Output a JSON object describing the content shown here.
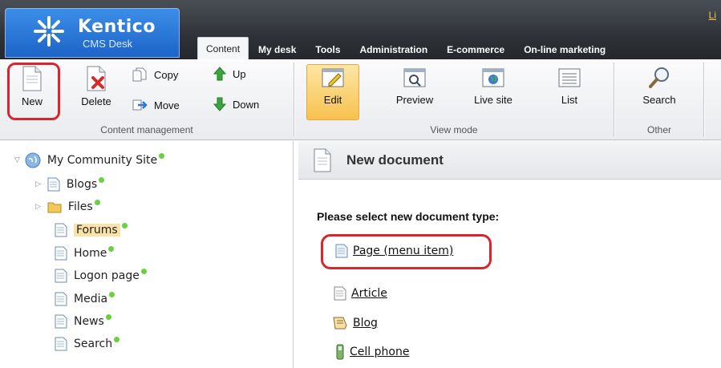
{
  "header": {
    "logo_title": "Kentico",
    "logo_subtitle": "CMS Desk",
    "corner_link": "Li",
    "tabs": [
      {
        "label": "Content",
        "active": true
      },
      {
        "label": "My desk",
        "active": false
      },
      {
        "label": "Tools",
        "active": false
      },
      {
        "label": "Administration",
        "active": false
      },
      {
        "label": "E-commerce",
        "active": false
      },
      {
        "label": "On-line marketing",
        "active": false
      }
    ]
  },
  "ribbon": {
    "content_management": {
      "label": "Content management",
      "new": "New",
      "delete": "Delete",
      "copy": "Copy",
      "move": "Move",
      "up": "Up",
      "down": "Down"
    },
    "view_mode": {
      "label": "View mode",
      "edit": "Edit",
      "preview": "Preview",
      "live_site": "Live site",
      "list": "List"
    },
    "other": {
      "label": "Other",
      "search": "Search"
    }
  },
  "tree": {
    "root": "My Community Site",
    "items": [
      {
        "label": "Blogs",
        "expandable": true,
        "icon": "page-icon",
        "selected": false
      },
      {
        "label": "Files",
        "expandable": true,
        "icon": "folder-icon",
        "selected": false
      },
      {
        "label": "Forums",
        "expandable": false,
        "icon": "page-icon",
        "selected": true
      },
      {
        "label": "Home",
        "expandable": false,
        "icon": "page-icon",
        "selected": false
      },
      {
        "label": "Logon page",
        "expandable": false,
        "icon": "page-icon",
        "selected": false
      },
      {
        "label": "Media",
        "expandable": false,
        "icon": "page-icon",
        "selected": false
      },
      {
        "label": "News",
        "expandable": false,
        "icon": "page-icon",
        "selected": false
      },
      {
        "label": "Search",
        "expandable": false,
        "icon": "page-icon",
        "selected": false
      }
    ]
  },
  "panel": {
    "title": "New document",
    "prompt": "Please select new document type:",
    "doc_types": [
      {
        "label": "Page (menu item)",
        "icon": "page-icon"
      },
      {
        "label": "Article",
        "icon": "article-icon"
      },
      {
        "label": "Blog",
        "icon": "blog-icon"
      },
      {
        "label": "Cell phone",
        "icon": "cell-phone-icon"
      }
    ]
  },
  "colors": {
    "highlight": "#d9262c",
    "published_dot": "#6ccf3f",
    "selected_bg": "#fbe2a6"
  }
}
